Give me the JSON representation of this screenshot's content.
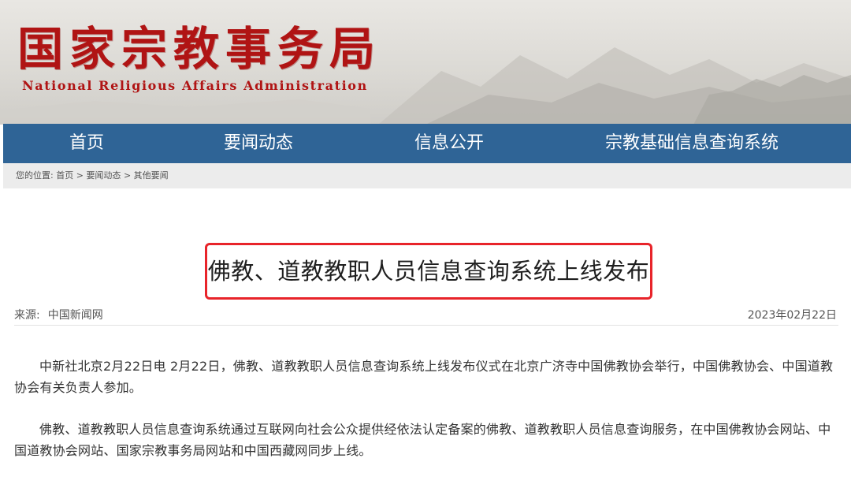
{
  "header": {
    "logo_cn": "国家宗教事务局",
    "logo_en": "National Religious Affairs Administration"
  },
  "nav": {
    "items": [
      {
        "label": "首页"
      },
      {
        "label": "要闻动态"
      },
      {
        "label": "信息公开"
      },
      {
        "label": "宗教基础信息查询系统"
      }
    ]
  },
  "breadcrumb": {
    "prefix": "您的位置:",
    "items": [
      {
        "label": "首页"
      },
      {
        "label": "要闻动态"
      },
      {
        "label": "其他要闻"
      }
    ],
    "separator": ">"
  },
  "article": {
    "title": "佛教、道教教职人员信息查询系统上线发布",
    "source_label": "来源:",
    "source": "中国新闻网",
    "date": "2023年02月22日",
    "paragraphs": [
      "中新社北京2月22日电 2月22日，佛教、道教教职人员信息查询系统上线发布仪式在北京广济寺中国佛教协会举行，中国佛教协会、中国道教协会有关负责人参加。",
      "佛教、道教教职人员信息查询系统通过互联网向社会公众提供经依法认定备案的佛教、道教教职人员信息查询服务，在中国佛教协会网站、中国道教协会网站、国家宗教事务局网站和中国西藏网同步上线。"
    ]
  },
  "colors": {
    "brand_red": "#b01414",
    "nav_blue": "#2f6496",
    "highlight_red": "#e8242a"
  }
}
